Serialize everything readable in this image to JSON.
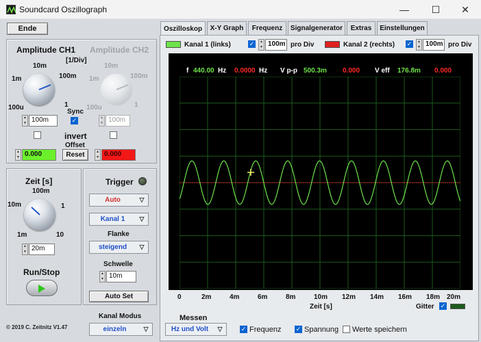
{
  "window": {
    "title": "Soundcard Oszillograph",
    "minimize": "—",
    "maximize": "☐",
    "close": "✕"
  },
  "controls": {
    "end_button": "Ende",
    "amplitude_ch1": {
      "title": "Amplitude CH1",
      "unit": "[1/Div]",
      "labels": [
        "10m",
        "100m",
        "1m",
        "1",
        "100u"
      ],
      "value": "100m"
    },
    "amplitude_ch2": {
      "title": "Amplitude CH2",
      "labels": [
        "10m",
        "100m",
        "1m",
        "1",
        "100u"
      ],
      "value": "100m"
    },
    "sync_label": "Sync",
    "sync_checked": true,
    "invert_label": "invert",
    "offset_label": "Offset",
    "offset_ch1": "0.000",
    "offset_ch2": "0.000",
    "reset_button": "Reset",
    "time": {
      "title": "Zeit [s]",
      "labels": [
        "100m",
        "10m",
        "1",
        "1m",
        "10"
      ],
      "value": "20m"
    },
    "run_stop_label": "Run/Stop",
    "copyright": "© 2019  C. Zeitnitz V1.47",
    "trigger": {
      "title": "Trigger",
      "mode": "Auto",
      "channel": "Kanal 1",
      "flank_label": "Flanke",
      "flank": "steigend",
      "threshold_label": "Schwelle",
      "threshold": "10m",
      "auto_set_button": "Auto Set"
    },
    "channel_mode": {
      "label": "Kanal Modus",
      "value": "einzeln"
    }
  },
  "tabs": [
    {
      "label": "Oszilloskop",
      "active": true
    },
    {
      "label": "X-Y Graph"
    },
    {
      "label": "Frequenz"
    },
    {
      "label": "Signalgenerator"
    },
    {
      "label": "Extras"
    },
    {
      "label": "Einstellungen"
    }
  ],
  "channels": {
    "ch1": {
      "label": "Kanal 1 (links)",
      "color": "#6ee34c",
      "enabled": true,
      "per_div": "100m",
      "per_div_label": "pro Div"
    },
    "ch2": {
      "label": "Kanal 2 (rechts)",
      "color": "#e02020",
      "enabled": true,
      "per_div": "100m",
      "per_div_label": "pro Div"
    }
  },
  "readout": {
    "f_label": "f",
    "f_ch1": "440.00",
    "f_unit_1": "Hz",
    "f_ch2": "0.0000",
    "f_unit_2": "Hz",
    "vpp_label": "V p-p",
    "vpp_ch1": "500.3m",
    "vpp_ch2": "0.000",
    "veff_label": "V eff",
    "veff_ch1": "176.8m",
    "veff_ch2": "0.000"
  },
  "plot": {
    "background": "#000000",
    "grid_color": "#1d5a1d",
    "x_ticks": [
      "0",
      "2m",
      "4m",
      "6m",
      "8m",
      "10m",
      "12m",
      "14m",
      "16m",
      "18m",
      "20m"
    ],
    "x_label": "Zeit [s]",
    "grid_label": "Gitter",
    "grid_on": true
  },
  "signal": {
    "frequency_hz": 440,
    "amplitude_div": 0.82,
    "window_s": 0.02
  },
  "measure": {
    "title": "Messen",
    "mode": "Hz und Volt",
    "frequency": {
      "label": "Frequenz",
      "checked": true
    },
    "voltage": {
      "label": "Spannung",
      "checked": true
    },
    "save": {
      "label": "Werte speichern",
      "checked": false
    }
  }
}
